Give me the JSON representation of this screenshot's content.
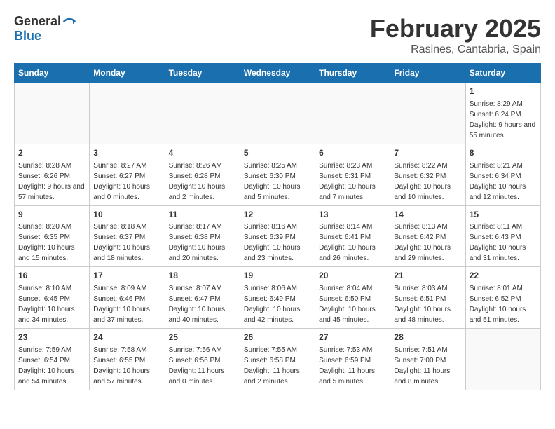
{
  "header": {
    "logo_general": "General",
    "logo_blue": "Blue",
    "month_year": "February 2025",
    "location": "Rasines, Cantabria, Spain"
  },
  "weekdays": [
    "Sunday",
    "Monday",
    "Tuesday",
    "Wednesday",
    "Thursday",
    "Friday",
    "Saturday"
  ],
  "weeks": [
    [
      {
        "day": "",
        "info": ""
      },
      {
        "day": "",
        "info": ""
      },
      {
        "day": "",
        "info": ""
      },
      {
        "day": "",
        "info": ""
      },
      {
        "day": "",
        "info": ""
      },
      {
        "day": "",
        "info": ""
      },
      {
        "day": "1",
        "info": "Sunrise: 8:29 AM\nSunset: 6:24 PM\nDaylight: 9 hours and 55 minutes."
      }
    ],
    [
      {
        "day": "2",
        "info": "Sunrise: 8:28 AM\nSunset: 6:26 PM\nDaylight: 9 hours and 57 minutes."
      },
      {
        "day": "3",
        "info": "Sunrise: 8:27 AM\nSunset: 6:27 PM\nDaylight: 10 hours and 0 minutes."
      },
      {
        "day": "4",
        "info": "Sunrise: 8:26 AM\nSunset: 6:28 PM\nDaylight: 10 hours and 2 minutes."
      },
      {
        "day": "5",
        "info": "Sunrise: 8:25 AM\nSunset: 6:30 PM\nDaylight: 10 hours and 5 minutes."
      },
      {
        "day": "6",
        "info": "Sunrise: 8:23 AM\nSunset: 6:31 PM\nDaylight: 10 hours and 7 minutes."
      },
      {
        "day": "7",
        "info": "Sunrise: 8:22 AM\nSunset: 6:32 PM\nDaylight: 10 hours and 10 minutes."
      },
      {
        "day": "8",
        "info": "Sunrise: 8:21 AM\nSunset: 6:34 PM\nDaylight: 10 hours and 12 minutes."
      }
    ],
    [
      {
        "day": "9",
        "info": "Sunrise: 8:20 AM\nSunset: 6:35 PM\nDaylight: 10 hours and 15 minutes."
      },
      {
        "day": "10",
        "info": "Sunrise: 8:18 AM\nSunset: 6:37 PM\nDaylight: 10 hours and 18 minutes."
      },
      {
        "day": "11",
        "info": "Sunrise: 8:17 AM\nSunset: 6:38 PM\nDaylight: 10 hours and 20 minutes."
      },
      {
        "day": "12",
        "info": "Sunrise: 8:16 AM\nSunset: 6:39 PM\nDaylight: 10 hours and 23 minutes."
      },
      {
        "day": "13",
        "info": "Sunrise: 8:14 AM\nSunset: 6:41 PM\nDaylight: 10 hours and 26 minutes."
      },
      {
        "day": "14",
        "info": "Sunrise: 8:13 AM\nSunset: 6:42 PM\nDaylight: 10 hours and 29 minutes."
      },
      {
        "day": "15",
        "info": "Sunrise: 8:11 AM\nSunset: 6:43 PM\nDaylight: 10 hours and 31 minutes."
      }
    ],
    [
      {
        "day": "16",
        "info": "Sunrise: 8:10 AM\nSunset: 6:45 PM\nDaylight: 10 hours and 34 minutes."
      },
      {
        "day": "17",
        "info": "Sunrise: 8:09 AM\nSunset: 6:46 PM\nDaylight: 10 hours and 37 minutes."
      },
      {
        "day": "18",
        "info": "Sunrise: 8:07 AM\nSunset: 6:47 PM\nDaylight: 10 hours and 40 minutes."
      },
      {
        "day": "19",
        "info": "Sunrise: 8:06 AM\nSunset: 6:49 PM\nDaylight: 10 hours and 42 minutes."
      },
      {
        "day": "20",
        "info": "Sunrise: 8:04 AM\nSunset: 6:50 PM\nDaylight: 10 hours and 45 minutes."
      },
      {
        "day": "21",
        "info": "Sunrise: 8:03 AM\nSunset: 6:51 PM\nDaylight: 10 hours and 48 minutes."
      },
      {
        "day": "22",
        "info": "Sunrise: 8:01 AM\nSunset: 6:52 PM\nDaylight: 10 hours and 51 minutes."
      }
    ],
    [
      {
        "day": "23",
        "info": "Sunrise: 7:59 AM\nSunset: 6:54 PM\nDaylight: 10 hours and 54 minutes."
      },
      {
        "day": "24",
        "info": "Sunrise: 7:58 AM\nSunset: 6:55 PM\nDaylight: 10 hours and 57 minutes."
      },
      {
        "day": "25",
        "info": "Sunrise: 7:56 AM\nSunset: 6:56 PM\nDaylight: 11 hours and 0 minutes."
      },
      {
        "day": "26",
        "info": "Sunrise: 7:55 AM\nSunset: 6:58 PM\nDaylight: 11 hours and 2 minutes."
      },
      {
        "day": "27",
        "info": "Sunrise: 7:53 AM\nSunset: 6:59 PM\nDaylight: 11 hours and 5 minutes."
      },
      {
        "day": "28",
        "info": "Sunrise: 7:51 AM\nSunset: 7:00 PM\nDaylight: 11 hours and 8 minutes."
      },
      {
        "day": "",
        "info": ""
      }
    ]
  ]
}
